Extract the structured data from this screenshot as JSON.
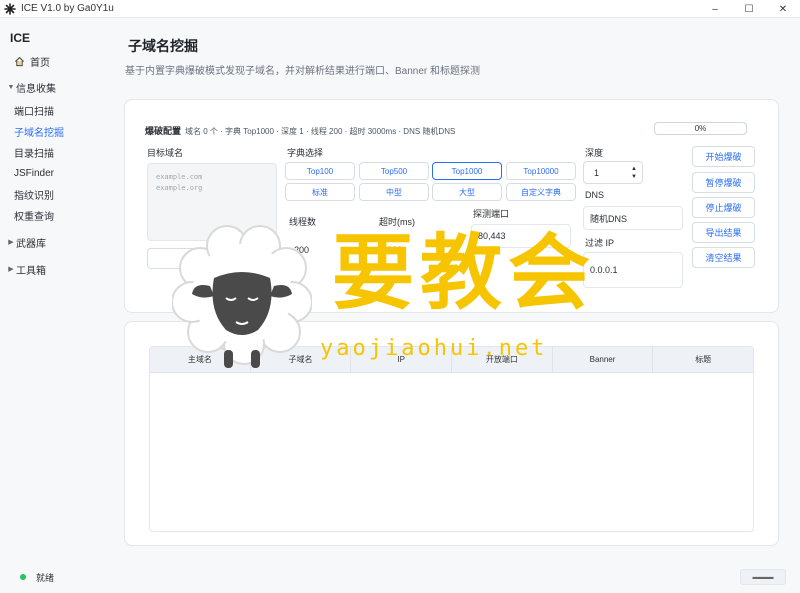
{
  "window": {
    "title": "ICE V1.0 by Ga0Y1u",
    "controls": [
      "–",
      "☐",
      "✕"
    ]
  },
  "sidebar": {
    "brand": "ICE",
    "home": "首页",
    "groups": [
      {
        "label": "信息收集",
        "expanded": true,
        "items": [
          "端口扫描",
          "子域名挖掘",
          "目录扫描",
          "JSFinder",
          "指纹识别",
          "权重查询"
        ]
      },
      {
        "label": "武器库",
        "expanded": false
      },
      {
        "label": "工具箱",
        "expanded": false
      }
    ],
    "active_item": "子域名挖掘"
  },
  "page": {
    "title": "子域名挖掘",
    "description": "基于内置字典爆破模式发现子域名，并对解析结果进行端口、Banner 和标题探测"
  },
  "config": {
    "title": "爆破配置",
    "summary": "域名 0 个 · 字典 Top1000 · 深度 1 · 线程 200 · 超时 3000ms · DNS 随机DNS",
    "progress_percent": 0,
    "progress_label": "0%",
    "target_label": "目标域名",
    "target_placeholder": "example.com\nexample.org",
    "import_button": "导入域名",
    "dict_label": "字典选择",
    "dict_options": [
      "Top100",
      "Top500",
      "Top1000",
      "Top10000",
      "标准",
      "中型",
      "大型",
      "自定义字典"
    ],
    "dict_selected": "Top1000",
    "threads_label": "线程数",
    "threads_value": "200",
    "timeout_label": "超时(ms)",
    "timeout_value": "3000",
    "ports_label": "探测端口",
    "ports_value": "80,443",
    "depth_label": "深度",
    "depth_value": "1",
    "dns_label": "DNS",
    "dns_value": "随机DNS",
    "filter_label": "过滤 IP",
    "filter_value": "0.0.0.1"
  },
  "actions": [
    "开始爆破",
    "暂停爆破",
    "停止爆破",
    "导出结果",
    "清空结果"
  ],
  "table": {
    "columns": [
      "主域名",
      "子域名",
      "IP",
      "开放端口",
      "Banner",
      "标题"
    ],
    "rows": []
  },
  "status": {
    "text": "就绪",
    "color": "#22c55e"
  },
  "watermark": {
    "text": "要教会",
    "url": "yaojiaohui.net"
  }
}
